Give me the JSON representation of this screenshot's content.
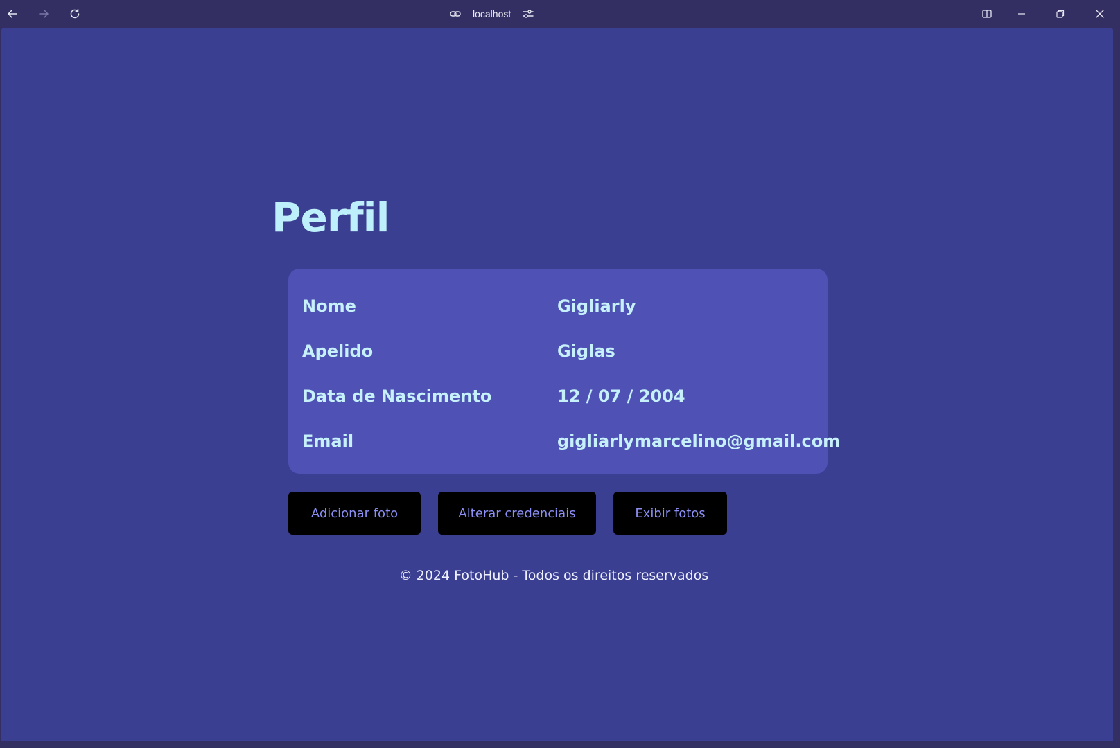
{
  "browser": {
    "url": "localhost",
    "icons": {
      "back": "arrow-left-icon",
      "forward": "arrow-right-icon",
      "reload": "reload-icon",
      "link": "link-icon",
      "settings": "sliders-icon",
      "split": "split-view-icon",
      "minimize": "minimize-icon",
      "restore": "restore-icon",
      "close": "close-icon"
    }
  },
  "page": {
    "title": "Perfil",
    "profile": [
      {
        "label": "Nome",
        "value": "Gigliarly"
      },
      {
        "label": "Apelido",
        "value": "Giglas"
      },
      {
        "label": "Data de Nascimento",
        "value": "12 / 07 / 2004"
      },
      {
        "label": "Email",
        "value": "gigliarlymarcelino@gmail.com"
      }
    ],
    "actions": {
      "add_photo": "Adicionar foto",
      "change_credentials": "Alterar credenciais",
      "show_photos": "Exibir fotos"
    },
    "footer": "© 2024 FotoHub - Todos os direitos reservados"
  },
  "colors": {
    "page_background": "#3b3f91",
    "card_background": "#4f51b4",
    "text_accent": "#c6f1fa",
    "button_background": "#000000",
    "button_text": "#8b8ff5"
  }
}
